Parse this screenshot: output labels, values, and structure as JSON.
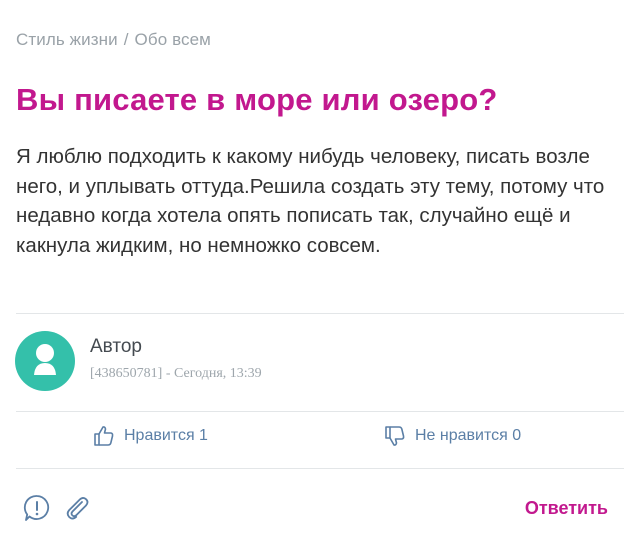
{
  "breadcrumb": {
    "category": "Стиль жизни",
    "separator": "/",
    "section": "Обо всем"
  },
  "post": {
    "title": "Вы писаете в море или озеро?",
    "body": "Я люблю подходить к какому нибудь человеку, писать возле него, и уплывать оттуда.Решила создать эту тему, потому что недавно когда хотела опять пописать так, случайно ещё и какнула жидким, но немножко совсем."
  },
  "author": {
    "name": "Автор",
    "meta": "[438650781] - Сегодня, 13:39",
    "avatar_icon": "user-silhouette-icon",
    "avatar_color": "#34c0aa"
  },
  "reactions": {
    "like_label": "Нравится 1",
    "like_icon": "thumbs-up-icon",
    "dislike_label": "Не нравится 0",
    "dislike_icon": "thumbs-down-icon"
  },
  "footer": {
    "report_icon": "exclamation-bubble-icon",
    "attach_icon": "paperclip-icon",
    "reply_label": "Ответить"
  },
  "colors": {
    "accent": "#c2188e",
    "link": "#5b7fa6",
    "muted": "#9aa2a8"
  }
}
